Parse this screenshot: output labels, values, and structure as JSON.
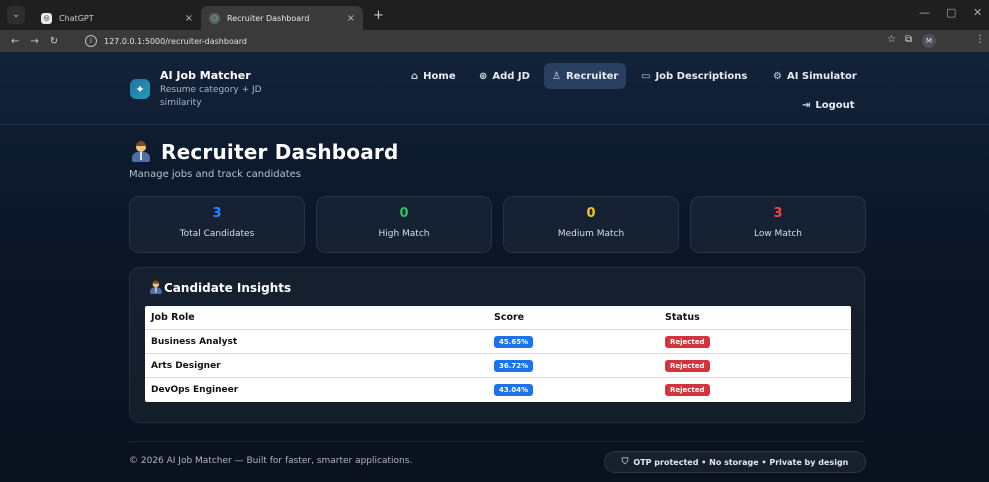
{
  "browser": {
    "tabs": [
      {
        "title": "ChatGPT",
        "close": "×"
      },
      {
        "title": "Recruiter Dashboard",
        "close": "×"
      }
    ],
    "new_tab": "+",
    "url": "127.0.0.1:5000/recruiter-dashboard",
    "profile_initial": "M"
  },
  "brand": {
    "title": "AI Job Matcher",
    "subtitle": "Resume category + JD similarity"
  },
  "nav": {
    "home": "Home",
    "add_jd": "Add JD",
    "recruiter": "Recruiter",
    "job_descriptions": "Job Descriptions",
    "ai_simulator": "AI Simulator",
    "logout": "Logout"
  },
  "page": {
    "title": "Recruiter Dashboard",
    "subtitle": "Manage jobs and track candidates"
  },
  "stats": [
    {
      "value": "3",
      "label": "Total Candidates",
      "color": "#1e88ff"
    },
    {
      "value": "0",
      "label": "High Match",
      "color": "#22c55e"
    },
    {
      "value": "0",
      "label": "Medium Match",
      "color": "#f5c518"
    },
    {
      "value": "3",
      "label": "Low Match",
      "color": "#ef4444"
    }
  ],
  "insights": {
    "title": "Candidate Insights",
    "columns": [
      "Job Role",
      "Score",
      "Status"
    ],
    "rows": [
      {
        "role": "Business Analyst",
        "score": "45.65%",
        "status": "Rejected"
      },
      {
        "role": "Arts Designer",
        "score": "36.72%",
        "status": "Rejected"
      },
      {
        "role": "DevOps Engineer",
        "score": "43.04%",
        "status": "Rejected"
      }
    ]
  },
  "footer": {
    "copyright": "© 2026 AI Job Matcher — Built for faster, smarter applications.",
    "badge": "OTP protected • No storage • Private by design"
  },
  "colors": {
    "accent_active_nav": "#2a3f60",
    "score_badge": "#1a73e8",
    "status_badge": "#d2343f"
  }
}
